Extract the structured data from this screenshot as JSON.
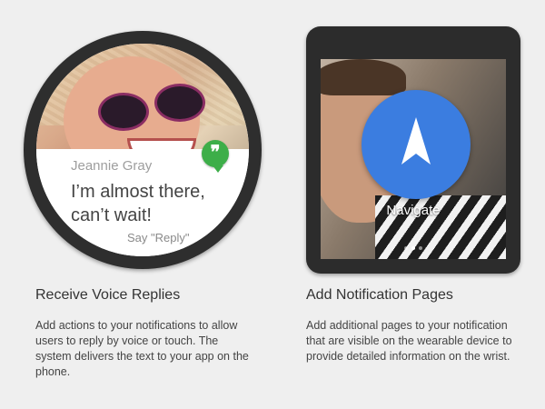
{
  "round_watch": {
    "sender": "Jeannie Gray",
    "message": "I’m almost there, can’t wait!",
    "reply_hint": "Say \"Reply\"",
    "app_icon": "hangouts-icon",
    "icon_color": "#3dae49"
  },
  "square_watch": {
    "action_label": "Navigate",
    "action_icon": "navigation-arrow-icon",
    "action_color": "#3b7de0"
  },
  "features": [
    {
      "title": "Receive Voice Replies",
      "description": "Add actions to your notifications to allow users to reply by voice or touch. The system delivers the text to your app on the phone."
    },
    {
      "title": "Add Notification Pages",
      "description": "Add additional pages to your notification that are visible on the wearable device to provide detailed information on the wrist."
    }
  ],
  "colors": {
    "background": "#efefef",
    "bezel": "#2e2e2e",
    "body_text": "#444444"
  }
}
